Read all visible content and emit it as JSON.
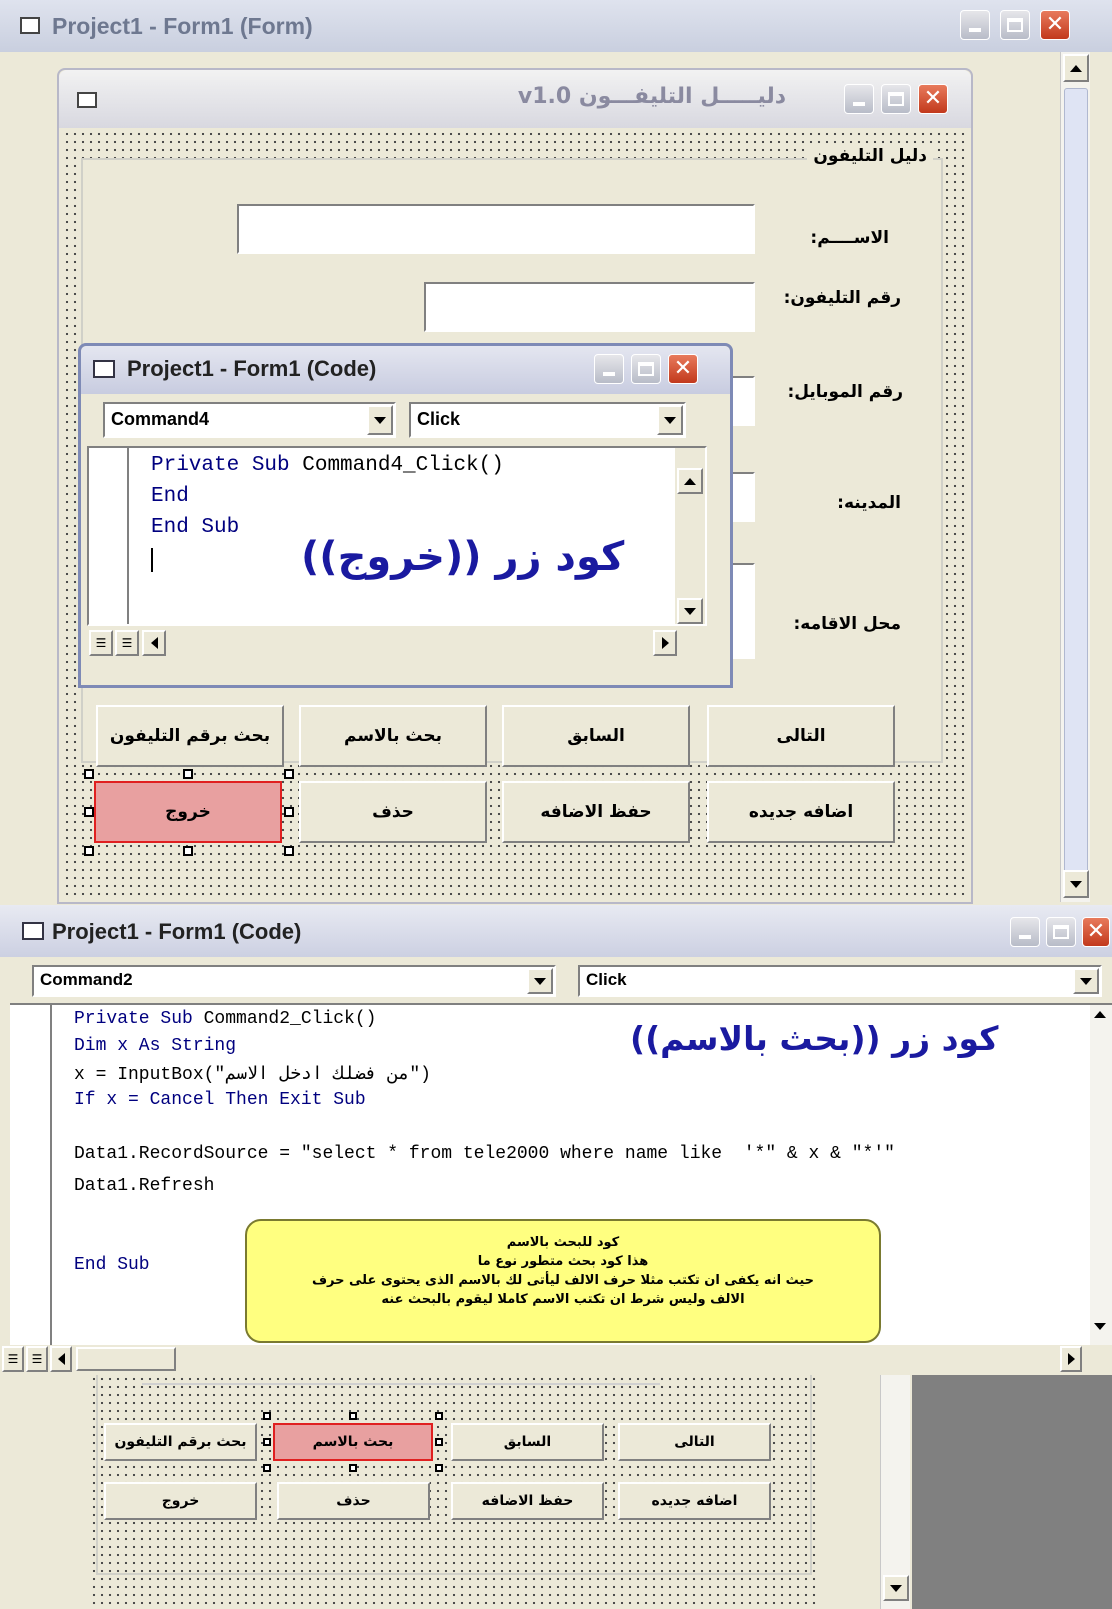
{
  "form_window": {
    "title": "Project1 - Form1 (Form)"
  },
  "app_form": {
    "title": "دليـــــل التليفـــون v1.0",
    "frame_title": "دليل التليفون",
    "labels": {
      "name": "الاســــم:",
      "phone": "رقم التليفون:",
      "mobile": "رقم الموبايل:",
      "city": "المدينه:",
      "address": "محل الاقامه:"
    },
    "buttons": {
      "next": "التالى",
      "previous": "السابق",
      "search_name": "بحث بالاسم",
      "search_phone": "بحث برقم التليفون",
      "add_new": "اضافه جديده",
      "save_add": "حفظ الاضافه",
      "delete": "حذف",
      "exit": "خروج"
    }
  },
  "code_window_small": {
    "title": "Project1 - Form1 (Code)",
    "object": "Command4",
    "event": "Click",
    "lines": [
      [
        "Private Sub ",
        "Command4_Click()"
      ],
      [
        "End",
        ""
      ],
      [
        "End Sub",
        ""
      ]
    ],
    "caption": "كود زر ((خروج))"
  },
  "code_window_large": {
    "title": "Project1 - Form1 (Code)",
    "object": "Command2",
    "event": "Click",
    "lines": [
      [
        "Private Sub ",
        "Command2_Click()"
      ],
      [
        "Dim x As String",
        ""
      ],
      [
        "x = InputBox(\"من فضلك ادخل الاسم\")",
        ""
      ],
      [
        "If x = Cancel Then Exit Sub",
        ""
      ],
      [
        "",
        ""
      ],
      [
        "Data1.RecordSource = \"select * from tele2000 where name like  '*\" & x & \"*'\"",
        ""
      ],
      [
        "",
        ""
      ],
      [
        "Data1.Refresh",
        ""
      ],
      [
        "",
        ""
      ],
      [
        "",
        ""
      ],
      [
        "End Sub",
        ""
      ]
    ],
    "caption": "كود زر ((بحث بالاسم))",
    "note_lines": [
      "كود للبحث بالاسم",
      "هذا كود بحث متطور نوع ما",
      "حيث انه يكفى ان تكتب مثلا حرف الالف ليأتى لك بالاسم الذى يحتوى على حرف",
      "الالف وليس شرط ان تكتب الاسم كاملا ليقوم بالبحث عنه"
    ]
  },
  "colors": {
    "selected_button": "#e8a0a0",
    "note_bg": "#ffff80",
    "code_keyword": "#00007f",
    "caption_blue": "#1a1aa0"
  }
}
